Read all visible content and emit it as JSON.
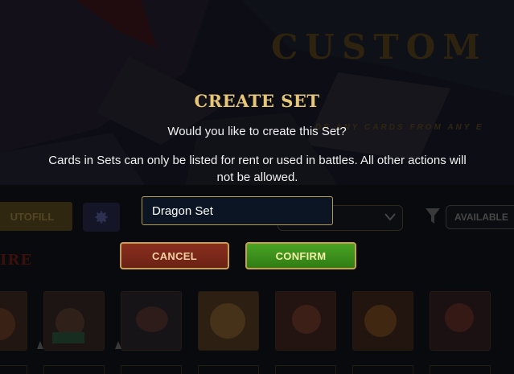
{
  "background": {
    "page_title": "CUSTOM",
    "subtitle": "DE ANY CARDS FROM ANY E",
    "autofill_label": "UTOFILL",
    "available_label": "AVAILABLE",
    "section_heading": "IRE",
    "gear_icon": "gear-icon",
    "filter_icon": "filter-icon",
    "dropdown_icon": "chevron-down-icon"
  },
  "modal": {
    "title": "CREATE SET",
    "question": "Would you like to create this Set?",
    "info": "Cards in Sets can only be listed for rent or used in battles. All other actions will not be allowed.",
    "set_name_value": "Dragon Set",
    "cancel_label": "CANCEL",
    "confirm_label": "CONFIRM"
  },
  "colors": {
    "title_gold": "#e7c776",
    "cancel_bg": "#7a2819",
    "confirm_bg": "#3e9120",
    "button_border": "#c9a04e",
    "input_bg": "#0b1524"
  }
}
